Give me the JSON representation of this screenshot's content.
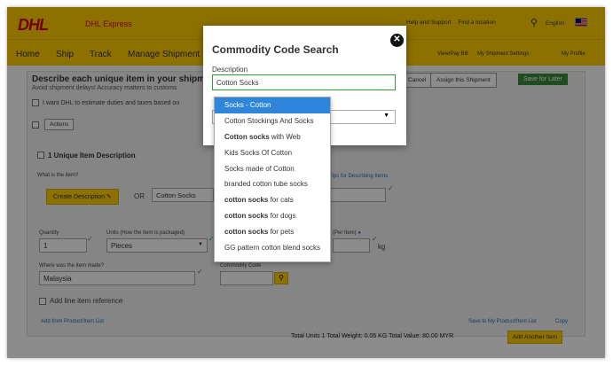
{
  "header": {
    "logo": "DHL",
    "brand": "DHL Express",
    "links": [
      "Help and Support",
      "Find a location",
      "English"
    ],
    "search_icon": "search-icon"
  },
  "nav": {
    "items": [
      "Home",
      "Ship",
      "Track",
      "Manage Shipment"
    ],
    "right_links": [
      "View/Pay Bill",
      "My Shipment Settings",
      "My Profile"
    ]
  },
  "page": {
    "heading": "Describe each unique item in your shipment",
    "subheading": "Avoid shipment delays! Accuracy matters to customs",
    "estimate_label": "I want DHL to estimate duties and taxes based on",
    "actions_label": "Actions",
    "cancel_label": "Cancel",
    "assign_label": "Assign this Shipment",
    "save_later_label": "Save for Later",
    "item_heading": "1  Unique Item Description",
    "what_label": "What is the item?",
    "create_desc_label": "Create Description",
    "or_label": "OR",
    "item_value": "Cotton Socks",
    "tips_link": "Tips for Describing Items",
    "quantity_label": "Quantity",
    "quantity_value": "1",
    "units_label": "Units (How the item is packaged)",
    "units_value": "Pieces",
    "weight_label": "(Per Item)",
    "weight_unit": "kg",
    "origin_label": "Where was the item made?",
    "origin_value": "Malaysia",
    "commodity_label": "Commodity Code",
    "add_ref_label": "Add line item reference",
    "add_product_link": "Add from Product/Item List",
    "save_product_link": "Save to My Product/Item List",
    "copy_link": "Copy",
    "totals": "Total Units 1   Total Weight: 0.05 KG   Total Value: 80.00 MYR",
    "add_another_label": "Add Another Item"
  },
  "modal": {
    "title": "Commodity Code Search",
    "desc_label": "Description",
    "desc_value": "Cotton Socks",
    "suggestions": [
      {
        "bold": "",
        "rest": "Socks - Cotton",
        "selected": true
      },
      {
        "bold": "",
        "rest": "Cotton Stockings And Socks",
        "selected": false
      },
      {
        "bold": "Cotton socks",
        "rest": " with Web",
        "selected": false
      },
      {
        "bold": "",
        "rest": "Kids Socks Of Cotton",
        "selected": false
      },
      {
        "bold": "",
        "rest": "Socks made of Cotton",
        "selected": false
      },
      {
        "bold": "",
        "rest": "branded cotton tube socks",
        "selected": false
      },
      {
        "bold": "cotton socks",
        "rest": " for cats",
        "selected": false
      },
      {
        "bold": "cotton socks",
        "rest": " for dogs",
        "selected": false
      },
      {
        "bold": "cotton socks",
        "rest": " for pets",
        "selected": false
      },
      {
        "bold": "",
        "rest": "GG pattern cotton blend socks",
        "selected": false
      }
    ]
  },
  "colors": {
    "dhl_yellow": "#ffcc00",
    "dhl_red": "#d40511",
    "select_blue": "#2e85d9"
  }
}
